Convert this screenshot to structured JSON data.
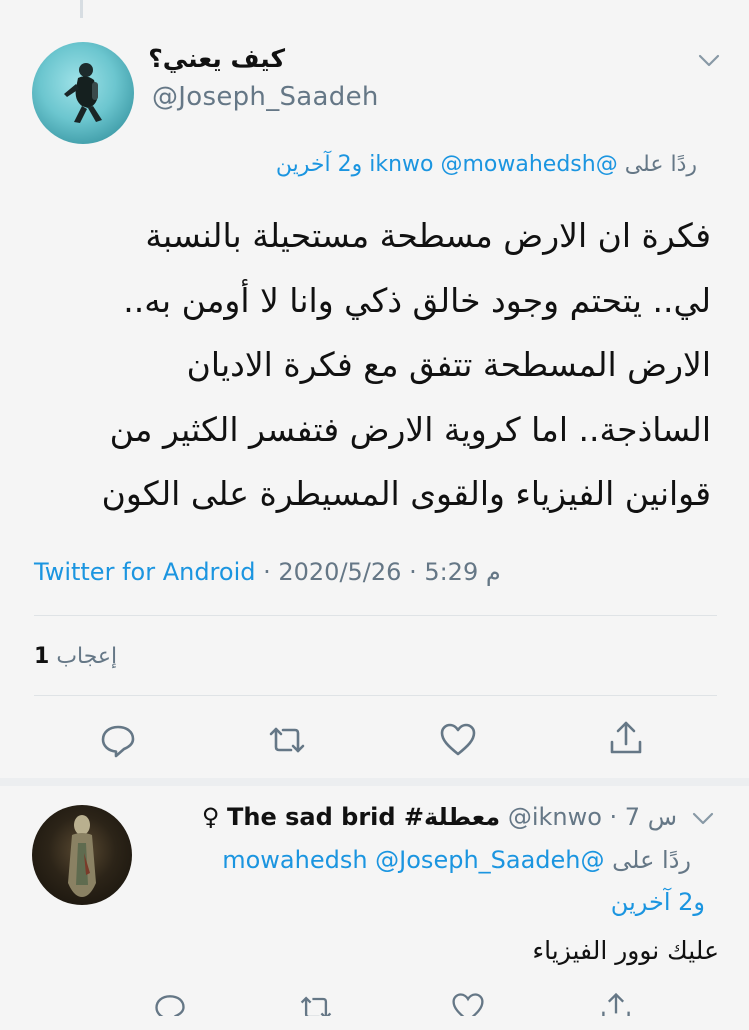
{
  "tweet": {
    "display_name": "كيف يعني؟",
    "handle": "@Joseph_Saadeh",
    "reply_prefix": "ردًا على",
    "reply_mentions": "@iknwo @mowahedsh",
    "reply_others": "و2 آخرين",
    "text_lines": [
      "فكرة ان الارض مسطحة مستحيلة بالنسبة",
      "لي.. يتحتم وجود خالق ذكي وانا لا أومن به..",
      "الارض المسطحة تتفق مع فكرة الاديان",
      "الساذجة.. اما كروية الارض فتفسر الكثير من",
      "قوانين الفيزياء والقوى المسيطرة على الكون"
    ],
    "client": "Twitter for Android",
    "dot": " · ",
    "date": "2020/5/26",
    "time": "5:29 م",
    "likes_count": "1",
    "likes_label": "إعجاب"
  },
  "actions": {
    "reply_icon": "reply-icon",
    "retweet_icon": "retweet-icon",
    "like_icon": "heart-icon",
    "share_icon": "share-icon"
  },
  "reply": {
    "name": "The sad brid #معطلة",
    "gender_symbol": "♀",
    "handle": "@iknwo",
    "age": "· 7 س",
    "reply_prefix": "ردًا على",
    "reply_mentions": "@mowahedsh @Joseph_Saadeh",
    "reply_others": "و2 آخرين",
    "text": "عليك نوور الفيزياء"
  },
  "colors": {
    "link": "#1b95e0",
    "muted": "#657786",
    "background": "#f5f5f5"
  }
}
